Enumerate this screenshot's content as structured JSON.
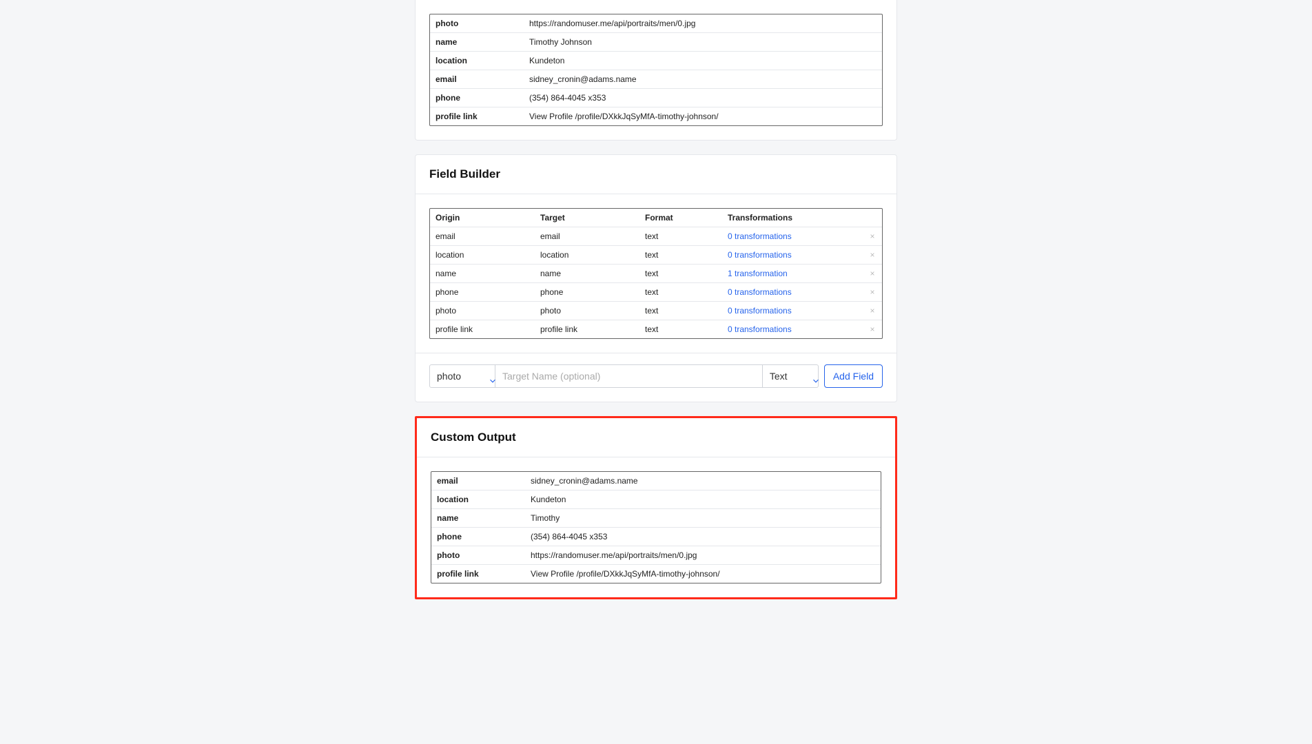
{
  "topTable": {
    "rows": [
      {
        "k": "photo",
        "v": "https://randomuser.me/api/portraits/men/0.jpg"
      },
      {
        "k": "name",
        "v": "Timothy Johnson"
      },
      {
        "k": "location",
        "v": "Kundeton"
      },
      {
        "k": "email",
        "v": "sidney_cronin@adams.name"
      },
      {
        "k": "phone",
        "v": "(354) 864-4045 x353"
      },
      {
        "k": "profile link",
        "v": "View Profile /profile/DXkkJqSyMfA-timothy-johnson/"
      }
    ]
  },
  "fieldBuilder": {
    "title": "Field Builder",
    "headers": {
      "origin": "Origin",
      "target": "Target",
      "format": "Format",
      "trans": "Transformations"
    },
    "rows": [
      {
        "origin": "email",
        "target": "email",
        "format": "text",
        "trans": "0 transformations"
      },
      {
        "origin": "location",
        "target": "location",
        "format": "text",
        "trans": "0 transformations"
      },
      {
        "origin": "name",
        "target": "name",
        "format": "text",
        "trans": "1 transformation"
      },
      {
        "origin": "phone",
        "target": "phone",
        "format": "text",
        "trans": "0 transformations"
      },
      {
        "origin": "photo",
        "target": "photo",
        "format": "text",
        "trans": "0 transformations"
      },
      {
        "origin": "profile link",
        "target": "profile link",
        "format": "text",
        "trans": "0 transformations"
      }
    ],
    "addRow": {
      "originValue": "photo",
      "targetPlaceholder": "Target Name (optional)",
      "formatValue": "Text",
      "button": "Add Field"
    }
  },
  "customOutput": {
    "title": "Custom Output",
    "rows": [
      {
        "k": "email",
        "v": "sidney_cronin@adams.name"
      },
      {
        "k": "location",
        "v": "Kundeton"
      },
      {
        "k": "name",
        "v": "Timothy"
      },
      {
        "k": "phone",
        "v": "(354) 864-4045 x353"
      },
      {
        "k": "photo",
        "v": "https://randomuser.me/api/portraits/men/0.jpg"
      },
      {
        "k": "profile link",
        "v": "View Profile /profile/DXkkJqSyMfA-timothy-johnson/"
      }
    ]
  }
}
